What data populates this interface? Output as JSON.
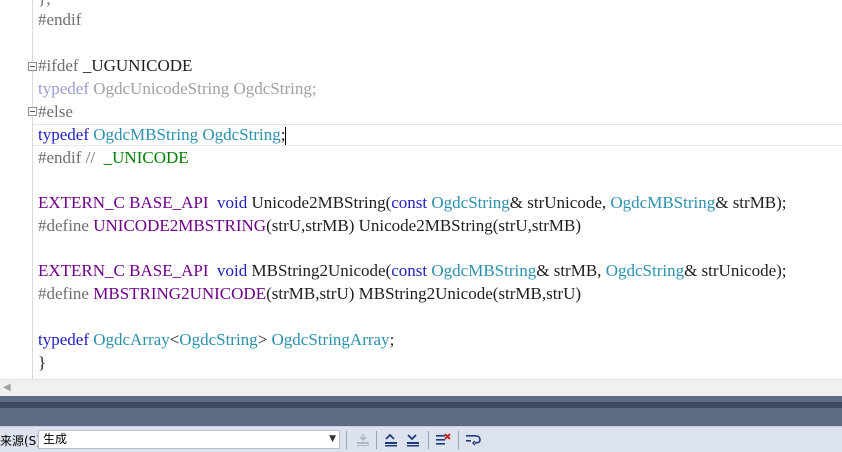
{
  "editor": {
    "lines": [
      {
        "id": "l0",
        "text": "};"
      },
      {
        "id": "l1",
        "text": "#endif"
      },
      {
        "id": "l3a",
        "text": "#ifdef"
      },
      {
        "id": "l3b",
        "text": " _UGUNICODE"
      },
      {
        "id": "l4a",
        "text": "typedef"
      },
      {
        "id": "l4b",
        "text": " OgdcUnicodeString OgdcString;"
      },
      {
        "id": "l5",
        "text": "#else"
      },
      {
        "id": "l6a",
        "text": "typedef"
      },
      {
        "id": "l6b",
        "text": "OgdcMBString"
      },
      {
        "id": "l6c",
        "text": "OgdcString"
      },
      {
        "id": "l6d",
        "text": ";"
      },
      {
        "id": "l7a",
        "text": "#endif // "
      },
      {
        "id": "l7b",
        "text": " _UNICODE"
      },
      {
        "id": "l9a",
        "text": "EXTERN_C"
      },
      {
        "id": "l9b",
        "text": "BASE_API"
      },
      {
        "id": "l9c",
        "text": "void"
      },
      {
        "id": "l9d",
        "text": " Unicode2MBString("
      },
      {
        "id": "l9e",
        "text": "const"
      },
      {
        "id": "l9f",
        "text": "OgdcString"
      },
      {
        "id": "l9g",
        "text": "& strUnicode, "
      },
      {
        "id": "l9h",
        "text": "OgdcMBString"
      },
      {
        "id": "l9i",
        "text": "& strMB);"
      },
      {
        "id": "l10a",
        "text": "#define"
      },
      {
        "id": "l10b",
        "text": "UNICODE2MBSTRING"
      },
      {
        "id": "l10c",
        "text": "(strU,strMB) Unicode2MBString(strU,strMB)"
      },
      {
        "id": "l12a",
        "text": "EXTERN_C"
      },
      {
        "id": "l12b",
        "text": "BASE_API"
      },
      {
        "id": "l12c",
        "text": "void"
      },
      {
        "id": "l12d",
        "text": " MBString2Unicode("
      },
      {
        "id": "l12e",
        "text": "const"
      },
      {
        "id": "l12f",
        "text": "OgdcMBString"
      },
      {
        "id": "l12g",
        "text": "& strMB, "
      },
      {
        "id": "l12h",
        "text": "OgdcString"
      },
      {
        "id": "l12i",
        "text": "& strUnicode);"
      },
      {
        "id": "l13a",
        "text": "#define"
      },
      {
        "id": "l13b",
        "text": "MBSTRING2UNICODE"
      },
      {
        "id": "l13c",
        "text": "(strMB,strU) MBString2Unicode(strMB,strU)"
      },
      {
        "id": "l15a",
        "text": "typedef"
      },
      {
        "id": "l15b",
        "text": "OgdcArray"
      },
      {
        "id": "l15c",
        "text": "<"
      },
      {
        "id": "l15d",
        "text": "OgdcString"
      },
      {
        "id": "l15e",
        "text": "> "
      },
      {
        "id": "l15f",
        "text": "OgdcStringArray"
      },
      {
        "id": "l15g",
        "text": ";"
      },
      {
        "id": "l16",
        "text": "}"
      }
    ]
  },
  "toolbar": {
    "source_label": "来源(S):",
    "source_value": "生成"
  },
  "icons": {
    "fold": "collapse-box-icon",
    "scroll_left": "scroll-left-arrow-icon",
    "find_message": "find-message-icon",
    "prev_message": "previous-message-icon",
    "next_message": "next-message-icon",
    "clear_all": "clear-all-icon",
    "word_wrap": "toggle-word-wrap-icon"
  }
}
